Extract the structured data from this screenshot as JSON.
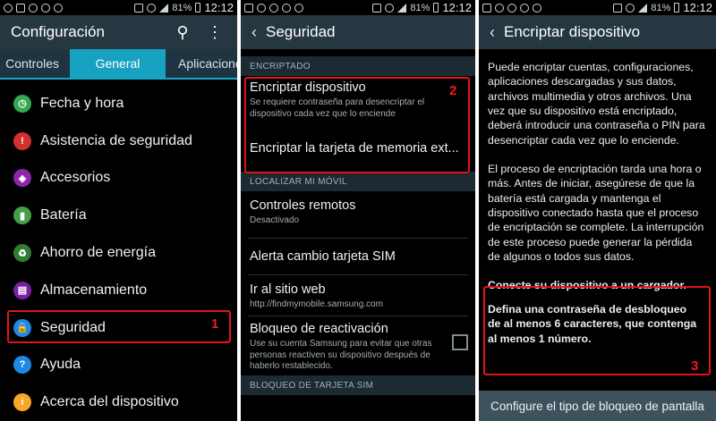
{
  "status": {
    "battery": "81%",
    "time": "12:12"
  },
  "panel1": {
    "title": "Configuración",
    "tabs": [
      "Controles",
      "General",
      "Aplicaciones"
    ],
    "items": [
      {
        "label": "Fecha y hora",
        "icon": "clock-icon",
        "color": "#34a853",
        "glyph": "◷"
      },
      {
        "label": "Asistencia de seguridad",
        "icon": "alert-icon",
        "color": "#d32f2f",
        "glyph": "!"
      },
      {
        "label": "Accesorios",
        "icon": "accessory-icon",
        "color": "#8e24aa",
        "glyph": "◈"
      },
      {
        "label": "Batería",
        "icon": "battery-icon",
        "color": "#43a047",
        "glyph": "▮"
      },
      {
        "label": "Ahorro de energía",
        "icon": "power-saving-icon",
        "color": "#2e7d32",
        "glyph": "♻"
      },
      {
        "label": "Almacenamiento",
        "icon": "storage-icon",
        "color": "#7b1fa2",
        "glyph": "▤"
      },
      {
        "label": "Seguridad",
        "icon": "lock-icon",
        "color": "#1e88e5",
        "glyph": "🔒"
      },
      {
        "label": "Ayuda",
        "icon": "help-icon",
        "color": "#1e88e5",
        "glyph": "?"
      },
      {
        "label": "Acerca del dispositivo",
        "icon": "info-icon",
        "color": "#f9a825",
        "glyph": "i"
      }
    ],
    "marker": "1"
  },
  "panel2": {
    "title": "Seguridad",
    "section_encrypt": "ENCRIPTADO",
    "encrypt_device": "Encriptar dispositivo",
    "encrypt_device_sub": "Se requiere contraseña para desencriptar el dispositivo cada vez que lo enciende",
    "encrypt_sd": "Encriptar la tarjeta de memoria ext...",
    "section_find": "LOCALIZAR MI MÓVIL",
    "remote": "Controles remotos",
    "remote_sub": "Desactivado",
    "sim_alert": "Alerta cambio tarjeta SIM",
    "website": "Ir al sitio web",
    "website_sub": "http://findmymobile.samsung.com",
    "reactivation": "Bloqueo de reactivación",
    "reactivation_sub": "Use su cuenta Samsung para evitar que otras personas reactiven su dispositivo después de haberlo restablecido.",
    "section_sim": "BLOQUEO DE TARJETA SIM",
    "marker": "2"
  },
  "panel3": {
    "title": "Encriptar dispositivo",
    "para1": "Puede encriptar cuentas, configuraciones, aplicaciones descargadas y sus datos, archivos multimedia y otros archivos. Una vez que su dispositivo está encriptado, deberá introducir una contraseña o PIN para desencriptar cada vez que lo enciende.",
    "para2": "El proceso de encriptación tarda una hora o más. Antes de iniciar, asegúrese de que la batería está cargada y mantenga el dispositivo conectado hasta que el proceso de encriptación se complete. La interrupción de este proceso puede generar la pérdida de algunos o todos sus datos.",
    "req1": "Conecte su dispositivo a un cargador.",
    "req2": "Defina una contraseña de desbloqueo de al menos 6 caracteres, que contenga al menos 1 número.",
    "button": "Configure el tipo de bloqueo de pantalla",
    "marker": "3"
  }
}
